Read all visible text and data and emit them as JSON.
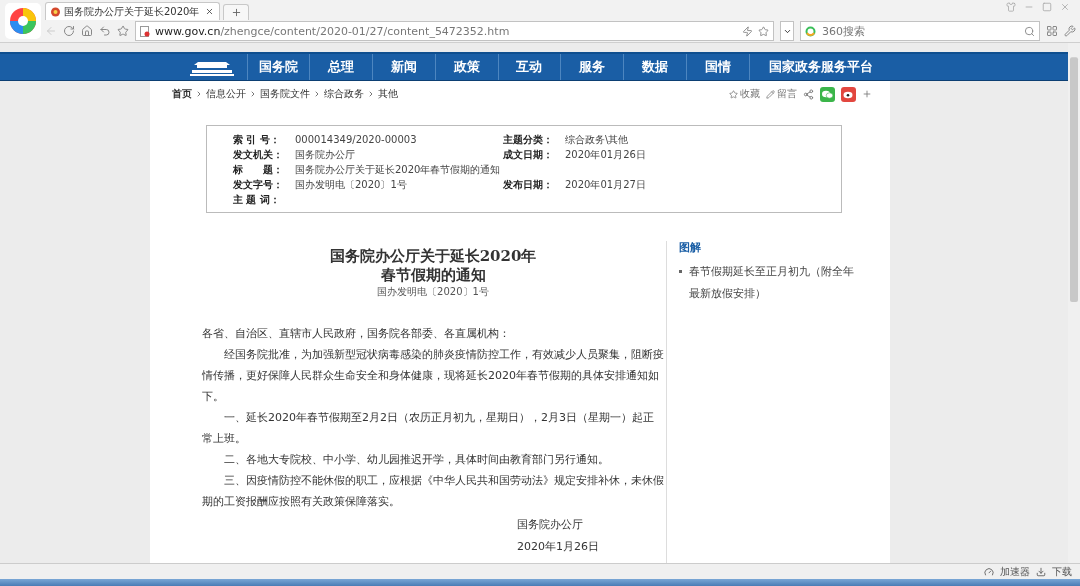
{
  "browser": {
    "tabs": [
      {
        "title": "国务院办公厅关于延长2020年",
        "selected": true
      }
    ],
    "address": {
      "host": "www.gov.cn",
      "path": "/zhengce/content/2020-01/27/content_5472352.htm"
    },
    "search": {
      "placeholder": "360搜索"
    }
  },
  "nav": {
    "items": [
      "国务院",
      "总理",
      "新闻",
      "政策",
      "互动",
      "服务",
      "数据",
      "国情",
      "国家政务服务平台"
    ]
  },
  "breadcrumb": [
    {
      "label": "首页",
      "bold": true
    },
    {
      "label": "信息公开",
      "bold": false
    },
    {
      "label": "国务院文件",
      "bold": false
    },
    {
      "label": "综合政务",
      "bold": false
    },
    {
      "label": "其他",
      "bold": false
    }
  ],
  "actions": {
    "favorite": "收藏",
    "comment": "留言"
  },
  "info": [
    {
      "left": {
        "label": "索 引 号：",
        "value": "000014349/2020-00003"
      },
      "right": {
        "label": "主题分类：",
        "value": "综合政务\\其他"
      }
    },
    {
      "left": {
        "label": "发文机关：",
        "value": "国务院办公厅"
      },
      "right": {
        "label": "成文日期：",
        "value": "2020年01月26日"
      }
    },
    {
      "left": {
        "label": "标　　题：",
        "value": "国务院办公厅关于延长2020年春节假期的通知"
      }
    },
    {
      "left": {
        "label": "发文字号：",
        "value": "国办发明电〔2020〕1号"
      },
      "right": {
        "label": "发布日期：",
        "value": "2020年01月27日"
      }
    },
    {
      "left": {
        "label": "主 题 词："
      }
    }
  ],
  "article": {
    "title_lines": [
      "国务院办公厅关于延长2020年",
      "春节假期的通知"
    ],
    "doc_number": "国办发明电〔2020〕1号",
    "paragraphs": [
      {
        "text": "各省、自治区、直辖市人民政府，国务院各部委、各直属机构：",
        "indent": false
      },
      {
        "text": "经国务院批准，为加强新型冠状病毒感染的肺炎疫情防控工作，有效减少人员聚集，阻断疫情传播，更好保障人民群众生命安全和身体健康，现将延长2020年春节假期的具体安排通知如下。",
        "indent": true
      },
      {
        "text": "一、延长2020年春节假期至2月2日（农历正月初九，星期日），2月3日（星期一）起正常上班。",
        "indent": true
      },
      {
        "text": "二、各地大专院校、中小学、幼儿园推迟开学，具体时间由教育部门另行通知。",
        "indent": true
      },
      {
        "text": "三、因疫情防控不能休假的职工，应根据《中华人民共和国劳动法》规定安排补休，未休假期的工资报酬应按照有关政策保障落实。",
        "indent": true
      }
    ],
    "signature": [
      "国务院办公厅",
      "2020年1月26日"
    ]
  },
  "sidebar": {
    "heading": "图解",
    "links": [
      "春节假期延长至正月初九（附全年最新放假安排）"
    ]
  },
  "status_bar": {
    "items": [
      "加速器",
      "下载"
    ]
  }
}
